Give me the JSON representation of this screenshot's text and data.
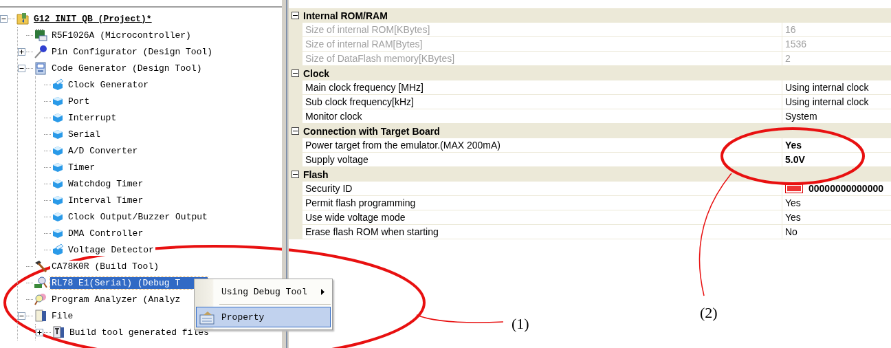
{
  "project_tree": {
    "items": [
      {
        "label": "G12 INIT QB (Project)*",
        "kind": "project",
        "expanded": true,
        "selected": false,
        "children": [
          {
            "label": "R5F1026A (Microcontroller)",
            "kind": "microcontroller",
            "selected": false
          },
          {
            "label": "Pin Configurator (Design Tool)",
            "kind": "pin-tool",
            "expanded": false,
            "selected": false
          },
          {
            "label": "Code Generator (Design Tool)",
            "kind": "code-tool",
            "expanded": true,
            "selected": false,
            "children": [
              {
                "label": "Clock Generator",
                "kind": "component-open",
                "selected": false
              },
              {
                "label": "Port",
                "kind": "component",
                "selected": false
              },
              {
                "label": "Interrupt",
                "kind": "component",
                "selected": false
              },
              {
                "label": "Serial",
                "kind": "component",
                "selected": false
              },
              {
                "label": "A/D Converter",
                "kind": "component",
                "selected": false
              },
              {
                "label": "Timer",
                "kind": "component",
                "selected": false
              },
              {
                "label": "Watchdog Timer",
                "kind": "component",
                "selected": false
              },
              {
                "label": "Interval Timer",
                "kind": "component",
                "selected": false
              },
              {
                "label": "Clock Output/Buzzer Output",
                "kind": "component",
                "selected": false
              },
              {
                "label": "DMA Controller",
                "kind": "component",
                "selected": false
              },
              {
                "label": "Voltage Detector",
                "kind": "component-open",
                "selected": false
              }
            ]
          },
          {
            "label": "CA78K0R (Build Tool)",
            "kind": "build-tool",
            "selected": false
          },
          {
            "label": "RL78 E1(Serial) (Debug T",
            "kind": "debug-tool",
            "selected": true
          },
          {
            "label": "Program Analyzer (Analyz",
            "kind": "analyzer",
            "selected": false
          },
          {
            "label": "File",
            "kind": "folder",
            "expanded": true,
            "selected": false,
            "children": [
              {
                "label": "Build tool generated files",
                "kind": "files",
                "expanded": false,
                "selected": false
              }
            ]
          }
        ]
      }
    ]
  },
  "context_menu": {
    "items": [
      {
        "label": "Using Debug Tool",
        "submenu": true,
        "selected": false
      },
      {
        "label": "Property",
        "submenu": false,
        "selected": true
      }
    ]
  },
  "property_grid": {
    "categories": [
      {
        "title": "Internal ROM/RAM",
        "expanded": true,
        "rows": [
          {
            "name": "Size of internal ROM[KBytes]",
            "value": "16",
            "disabled": true,
            "modified": false
          },
          {
            "name": "Size of internal RAM[Bytes]",
            "value": "1536",
            "disabled": true,
            "modified": false
          },
          {
            "name": "Size of DataFlash memory[KBytes]",
            "value": "2",
            "disabled": true,
            "modified": false
          }
        ]
      },
      {
        "title": "Clock",
        "expanded": true,
        "rows": [
          {
            "name": "Main clock frequency [MHz]",
            "value": "Using internal clock",
            "disabled": false,
            "modified": false
          },
          {
            "name": "Sub clock frequency[kHz]",
            "value": "Using internal clock",
            "disabled": false,
            "modified": false
          },
          {
            "name": "Monitor clock",
            "value": "System",
            "disabled": false,
            "modified": false
          }
        ]
      },
      {
        "title": "Connection with Target Board",
        "expanded": true,
        "rows": [
          {
            "name": "Power target from the emulator.(MAX 200mA)",
            "value": "Yes",
            "disabled": false,
            "modified": true
          },
          {
            "name": "Supply voltage",
            "value": "5.0V",
            "disabled": false,
            "modified": true
          }
        ]
      },
      {
        "title": "Flash",
        "expanded": true,
        "rows": [
          {
            "name": "Security ID",
            "value": "00000000000000",
            "hex": true,
            "disabled": false,
            "modified": true
          },
          {
            "name": "Permit flash programming",
            "value": "Yes",
            "disabled": false,
            "modified": false
          },
          {
            "name": "Use wide voltage mode",
            "value": "Yes",
            "disabled": false,
            "modified": false
          },
          {
            "name": "Erase flash ROM when starting",
            "value": "No",
            "disabled": false,
            "modified": false
          }
        ]
      }
    ]
  },
  "annotations": [
    {
      "label": "(1)"
    },
    {
      "label": "(2)"
    }
  ]
}
